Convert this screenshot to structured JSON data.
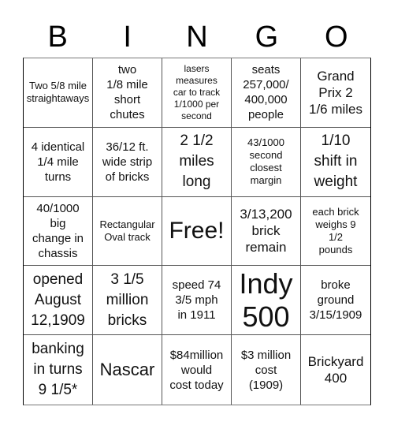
{
  "header": {
    "letters": [
      "B",
      "I",
      "N",
      "G",
      "O"
    ]
  },
  "board": {
    "cells": [
      {
        "text": "Two 5/8 mile\nstraightaways",
        "size": "s-sm"
      },
      {
        "text": "two\n1/8 mile\nshort\nchutes",
        "size": "s-md"
      },
      {
        "text": "lasers\nmeasures\ncar to track\n1/1000 per\nsecond",
        "size": "s-xs"
      },
      {
        "text": "seats\n257,000/\n400,000\npeople",
        "size": "s-md"
      },
      {
        "text": "Grand\nPrix 2\n1/6 miles",
        "size": "s-lg"
      },
      {
        "text": "4 identical\n1/4 mile\nturns",
        "size": "s-md"
      },
      {
        "text": "36/12 ft.\nwide strip\nof bricks",
        "size": "s-md"
      },
      {
        "text": "2 1/2\nmiles\nlong",
        "size": "s-xl"
      },
      {
        "text": "43/1000\nsecond\nclosest\nmargin",
        "size": "s-sm"
      },
      {
        "text": "1/10\nshift in\nweight",
        "size": "s-xl"
      },
      {
        "text": "40/1000\nbig\nchange in\nchassis",
        "size": "s-md"
      },
      {
        "text": "Rectangular\nOval track",
        "size": "s-sm"
      },
      {
        "text": "Free!",
        "size": "s-free"
      },
      {
        "text": "3/13,200\nbrick\nremain",
        "size": "s-lg"
      },
      {
        "text": "each brick\nweighs 9\n1/2\npounds",
        "size": "s-sm"
      },
      {
        "text": "opened\nAugust\n12,1909",
        "size": "s-xl"
      },
      {
        "text": "3 1/5\nmillion\nbricks",
        "size": "s-xl"
      },
      {
        "text": "speed 74\n3/5 mph\nin 1911",
        "size": "s-md"
      },
      {
        "text": "Indy\n500",
        "size": "s-huge"
      },
      {
        "text": "broke\nground\n3/15/1909",
        "size": "s-md"
      },
      {
        "text": "banking\nin turns\n9 1/5*",
        "size": "s-xl"
      },
      {
        "text": "Nascar",
        "size": "s-xxl"
      },
      {
        "text": "$84million\nwould\ncost today",
        "size": "s-md"
      },
      {
        "text": "$3 million\ncost\n(1909)",
        "size": "s-md"
      },
      {
        "text": "Brickyard\n400",
        "size": "s-lg"
      }
    ]
  }
}
